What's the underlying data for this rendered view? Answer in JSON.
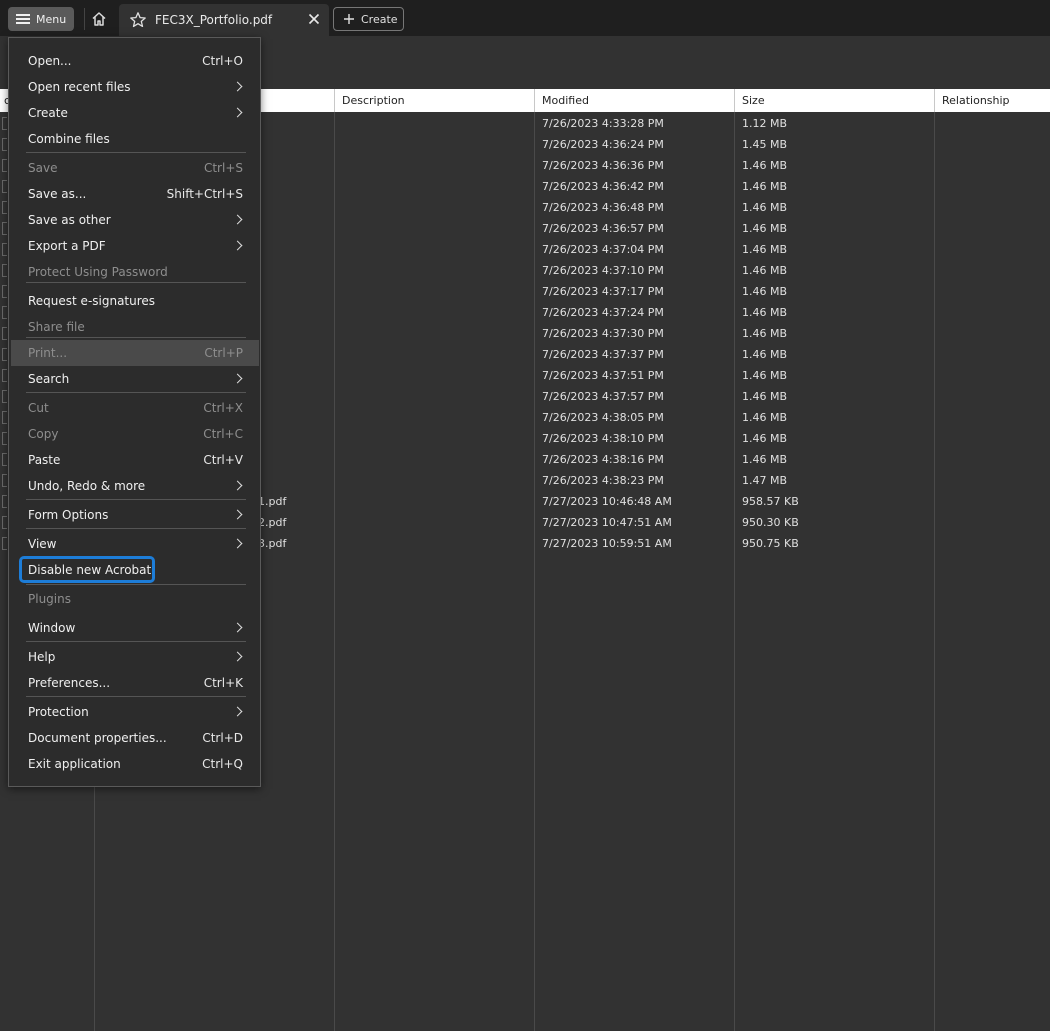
{
  "toolbar": {
    "menu_label": "Menu",
    "tab_title": "FEC3X_Portfolio.pdf",
    "create_label": "Create"
  },
  "table": {
    "headers": [
      "Description",
      "Modified",
      "Size",
      "Relationship"
    ],
    "first_header_partial": "c",
    "rows": [
      {
        "name": "",
        "modified": "7/26/2023 4:33:28 PM",
        "size": "1.12 MB"
      },
      {
        "name": "",
        "modified": "7/26/2023 4:36:24 PM",
        "size": "1.45 MB"
      },
      {
        "name": "",
        "modified": "7/26/2023 4:36:36 PM",
        "size": "1.46 MB"
      },
      {
        "name": "",
        "modified": "7/26/2023 4:36:42 PM",
        "size": "1.46 MB"
      },
      {
        "name": "",
        "modified": "7/26/2023 4:36:48 PM",
        "size": "1.46 MB"
      },
      {
        "name": "",
        "modified": "7/26/2023 4:36:57 PM",
        "size": "1.46 MB"
      },
      {
        "name": "",
        "modified": "7/26/2023 4:37:04 PM",
        "size": "1.46 MB"
      },
      {
        "name": "",
        "modified": "7/26/2023 4:37:10 PM",
        "size": "1.46 MB"
      },
      {
        "name": "",
        "modified": "7/26/2023 4:37:17 PM",
        "size": "1.46 MB"
      },
      {
        "name": "",
        "modified": "7/26/2023 4:37:24 PM",
        "size": "1.46 MB"
      },
      {
        "name": "",
        "modified": "7/26/2023 4:37:30 PM",
        "size": "1.46 MB"
      },
      {
        "name": "",
        "modified": "7/26/2023 4:37:37 PM",
        "size": "1.46 MB"
      },
      {
        "name": "",
        "modified": "7/26/2023 4:37:51 PM",
        "size": "1.46 MB"
      },
      {
        "name": "",
        "modified": "7/26/2023 4:37:57 PM",
        "size": "1.46 MB"
      },
      {
        "name": "",
        "modified": "7/26/2023 4:38:05 PM",
        "size": "1.46 MB"
      },
      {
        "name": "",
        "modified": "7/26/2023 4:38:10 PM",
        "size": "1.46 MB"
      },
      {
        "name": "",
        "modified": "7/26/2023 4:38:16 PM",
        "size": "1.46 MB"
      },
      {
        "name": "",
        "modified": "7/26/2023 4:38:23 PM",
        "size": "1.47 MB"
      },
      {
        "name": "1.pdf",
        "modified": "7/27/2023 10:46:48 AM",
        "size": "958.57 KB"
      },
      {
        "name": "2.pdf",
        "modified": "7/27/2023 10:47:51 AM",
        "size": "950.30 KB"
      },
      {
        "name": "3.pdf",
        "modified": "7/27/2023 10:59:51 AM",
        "size": "950.75 KB"
      }
    ]
  },
  "menu": {
    "items": [
      {
        "label": "Open...",
        "shortcut": "Ctrl+O"
      },
      {
        "label": "Open recent files",
        "submenu": true
      },
      {
        "label": "Create",
        "submenu": true
      },
      {
        "label": "Combine files"
      },
      {
        "label": "Save",
        "shortcut": "Ctrl+S",
        "disabled": true
      },
      {
        "label": "Save as...",
        "shortcut": "Shift+Ctrl+S"
      },
      {
        "label": "Save as other",
        "submenu": true
      },
      {
        "label": "Export a PDF",
        "submenu": true
      },
      {
        "label": "Protect Using Password",
        "disabled": true
      },
      {
        "label": "Request e-signatures"
      },
      {
        "label": "Share file",
        "disabled": true
      },
      {
        "label": "Print...",
        "shortcut": "Ctrl+P",
        "disabled": true,
        "highlighted": true
      },
      {
        "label": "Search",
        "submenu": true
      },
      {
        "label": "Cut",
        "shortcut": "Ctrl+X",
        "disabled": true
      },
      {
        "label": "Copy",
        "shortcut": "Ctrl+C",
        "disabled": true
      },
      {
        "label": "Paste",
        "shortcut": "Ctrl+V"
      },
      {
        "label": "Undo, Redo & more",
        "submenu": true
      },
      {
        "label": "Form Options",
        "submenu": true
      },
      {
        "label": "View",
        "submenu": true
      },
      {
        "label": "Disable new Acrobat",
        "focused": true
      },
      {
        "label": "Plugins",
        "disabled": true
      },
      {
        "label": "Window",
        "submenu": true
      },
      {
        "label": "Help",
        "submenu": true
      },
      {
        "label": "Preferences...",
        "shortcut": "Ctrl+K"
      },
      {
        "label": "Protection",
        "submenu": true
      },
      {
        "label": "Document properties...",
        "shortcut": "Ctrl+D"
      },
      {
        "label": "Exit application",
        "shortcut": "Ctrl+Q"
      }
    ]
  },
  "colors": {
    "focus_ring": "#1d7dd8",
    "menu_bg": "#2c2c2c",
    "page_bg": "#323232"
  }
}
